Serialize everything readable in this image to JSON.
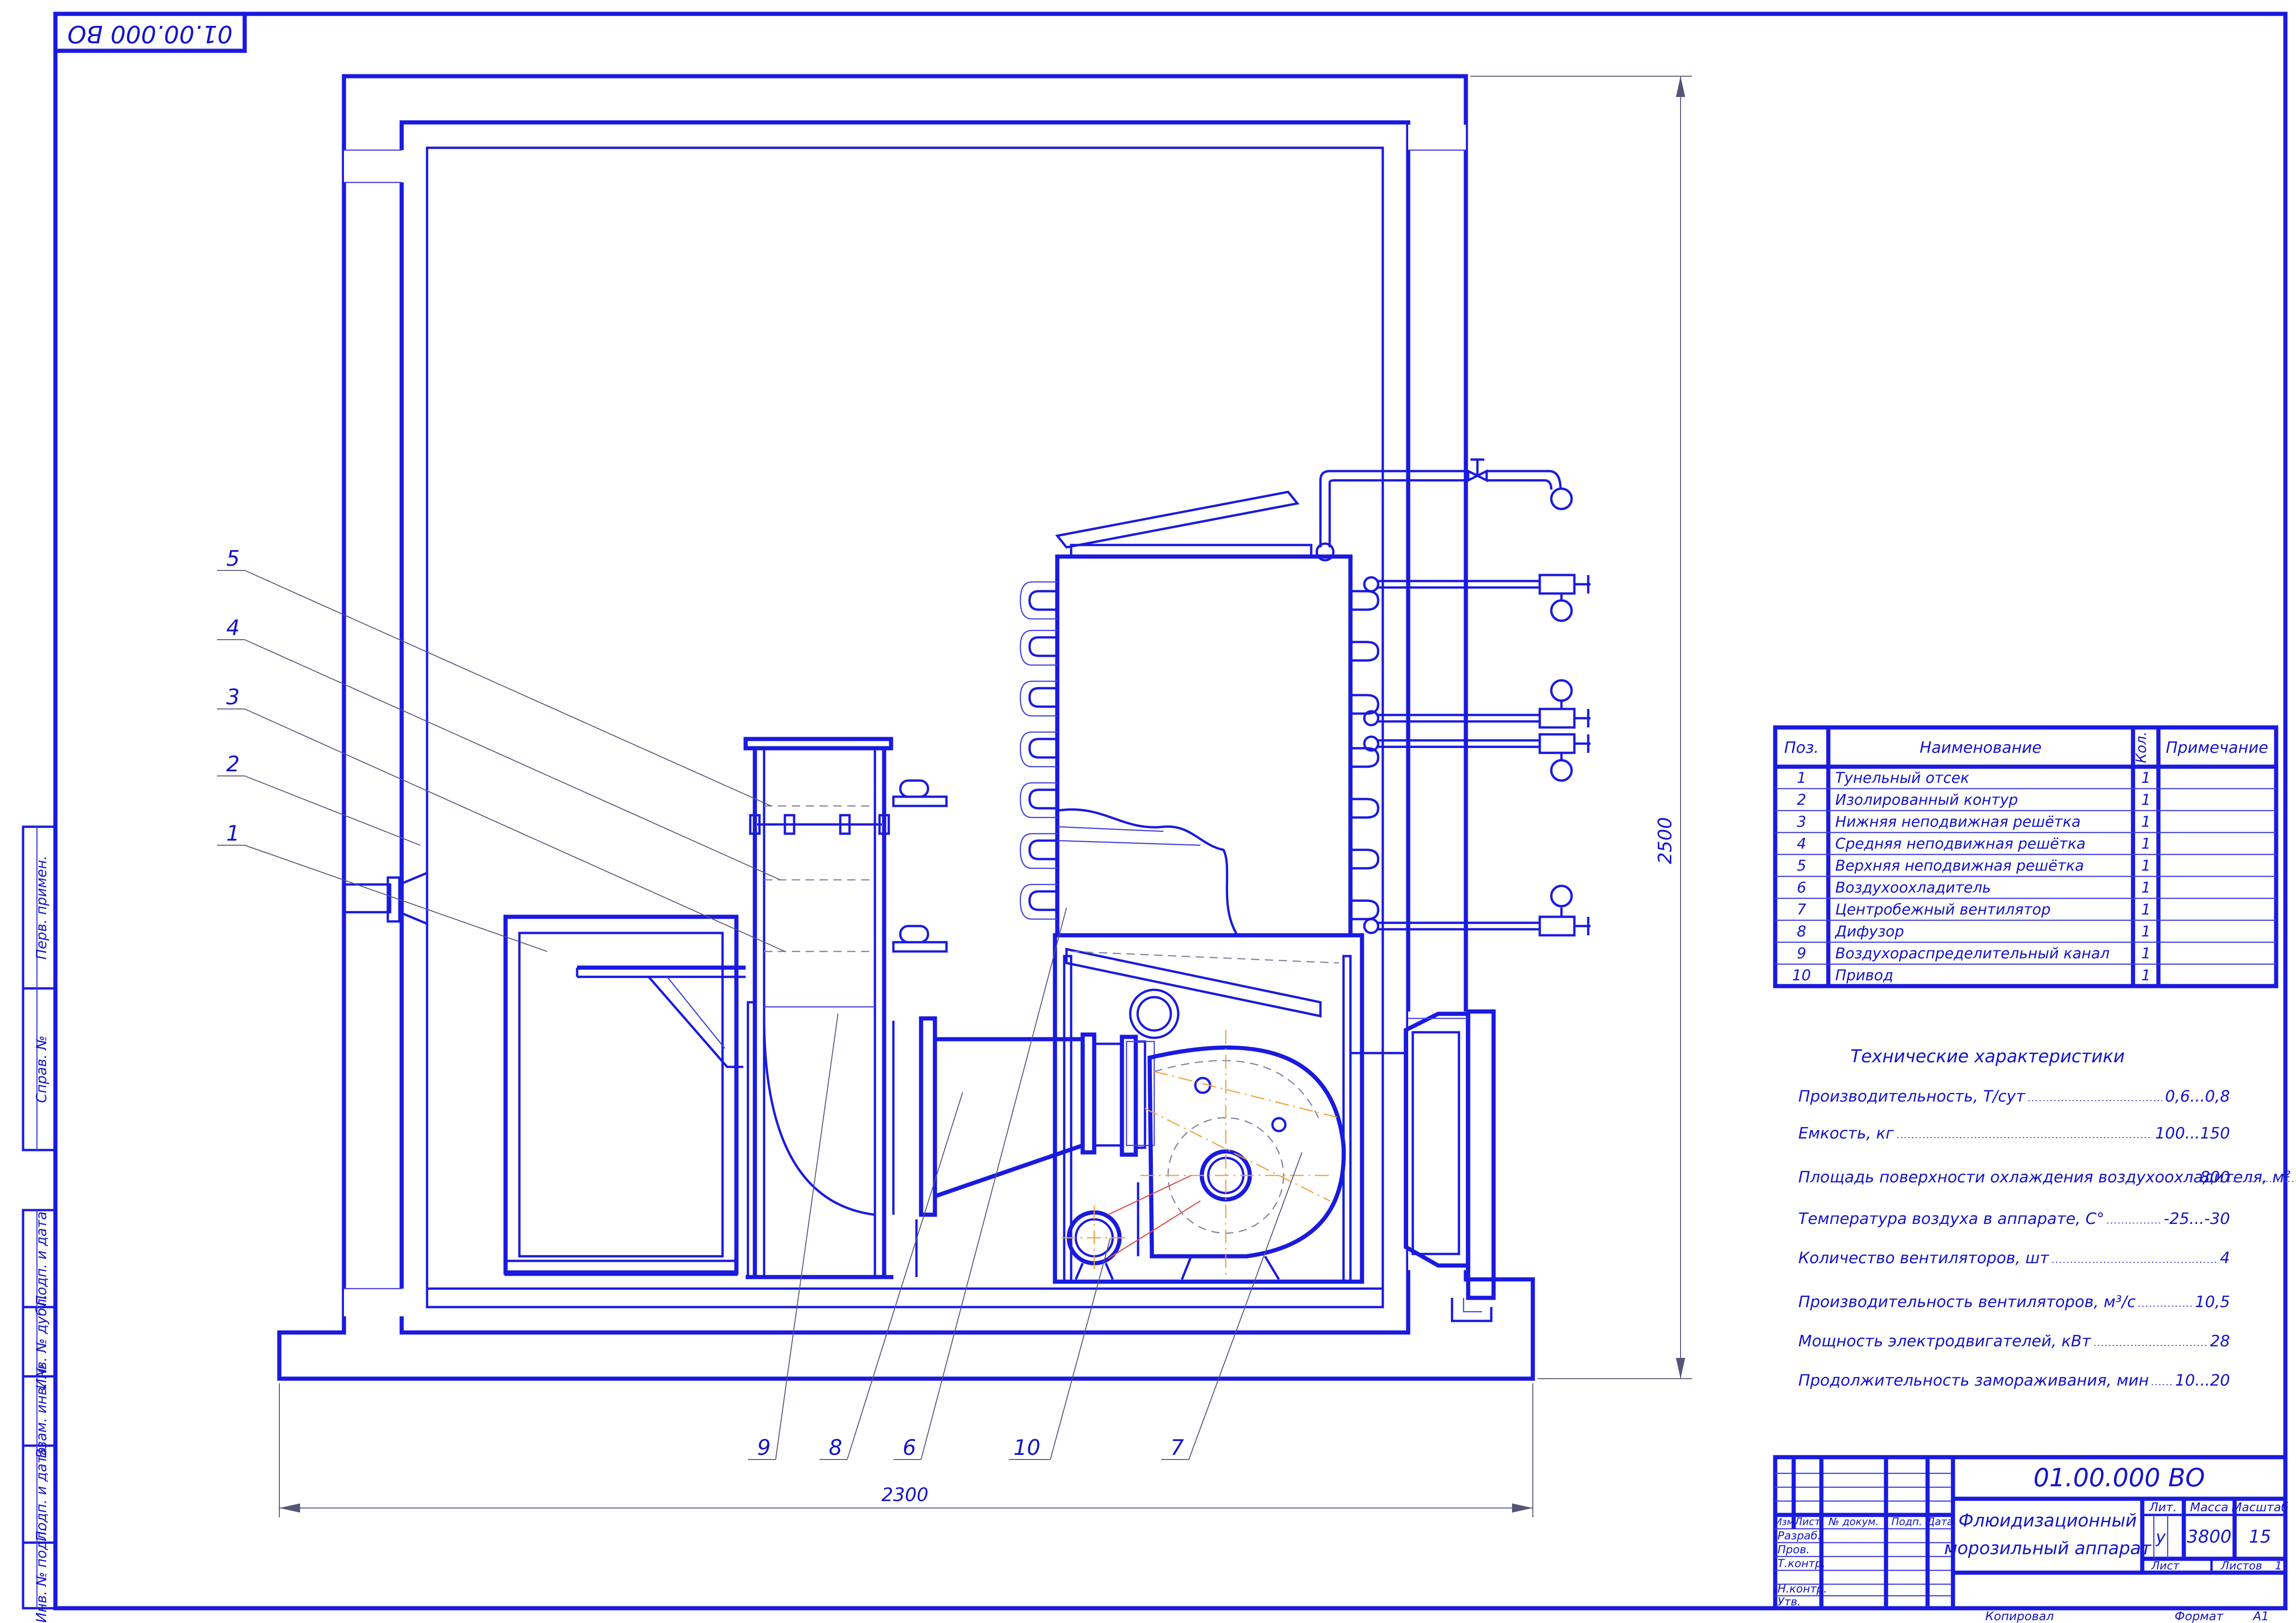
{
  "drawing": {
    "stamp_rotated": "01.00.000 ВО",
    "side_labels": [
      "Перв. примен.",
      "Справ. №",
      "Подп. и дата",
      "Инв. № дубл.",
      "Взам. инв. №",
      "Подп. и дата",
      "Инв. № подл."
    ],
    "dim_width": "2300",
    "dim_height": "2500",
    "callouts": [
      "1",
      "2",
      "3",
      "4",
      "5",
      "6",
      "7",
      "8",
      "9",
      "10"
    ]
  },
  "parts_table": {
    "headers": {
      "pos": "Поз.",
      "name": "Наименование",
      "qty": "Кол.",
      "note": "Примечание"
    },
    "rows": [
      {
        "pos": "1",
        "name": "Тунельный отсек",
        "qty": "1",
        "note": ""
      },
      {
        "pos": "2",
        "name": "Изолированный контур",
        "qty": "1",
        "note": ""
      },
      {
        "pos": "3",
        "name": "Нижняя неподвижная решётка",
        "qty": "1",
        "note": ""
      },
      {
        "pos": "4",
        "name": "Средняя неподвижная решётка",
        "qty": "1",
        "note": ""
      },
      {
        "pos": "5",
        "name": "Верхняя неподвижная решётка",
        "qty": "1",
        "note": ""
      },
      {
        "pos": "6",
        "name": "Воздухоохладитель",
        "qty": "1",
        "note": ""
      },
      {
        "pos": "7",
        "name": "Центробежный вентилятор",
        "qty": "1",
        "note": ""
      },
      {
        "pos": "8",
        "name": "Дифузор",
        "qty": "1",
        "note": ""
      },
      {
        "pos": "9",
        "name": "Воздухораспределительный канал",
        "qty": "1",
        "note": ""
      },
      {
        "pos": "10",
        "name": "Привод",
        "qty": "1",
        "note": ""
      }
    ]
  },
  "tech_specs": {
    "title": "Технические характеристики",
    "rows": [
      {
        "label": "Производительность, Т/сут",
        "value": "0,6...0,8"
      },
      {
        "label": "Емкость, кг",
        "value": "100...150"
      },
      {
        "label": "Площадь поверхности охлаждения воздухоохладителя, м²",
        "value": "800"
      },
      {
        "label": "Температура воздуха в аппарате, С°",
        "value": "-25...-30"
      },
      {
        "label": "Количество вентиляторов, шт",
        "value": "4"
      },
      {
        "label": "Производительность вентиляторов, м³/с",
        "value": "10,5"
      },
      {
        "label": "Мощность электродвигателей, кВт",
        "value": "28"
      },
      {
        "label": "Продолжительность замораживания, мин",
        "value": "10...20"
      }
    ]
  },
  "title_block": {
    "designation": "01.00.000 ВО",
    "product_name_line1": "Флюидизационный",
    "product_name_line2": "морозильный аппарат",
    "col_headers": [
      "Изм",
      "Лист",
      "№ докум.",
      "Подп.",
      "Дата"
    ],
    "roles": [
      "Разраб.",
      "Пров.",
      "Т.контр.",
      "Н.контр.",
      "Утв."
    ],
    "lit_label": "Лит.",
    "mass_label": "Масса",
    "scale_label": "Масштаб",
    "lit_value": "у",
    "mass_value": "3800",
    "scale_value": "15",
    "sheet_label": "Лист",
    "sheets_label": "Листов",
    "sheets_value": "1",
    "copied": "Копировал",
    "format_label": "Формат",
    "format_value": "А1"
  }
}
